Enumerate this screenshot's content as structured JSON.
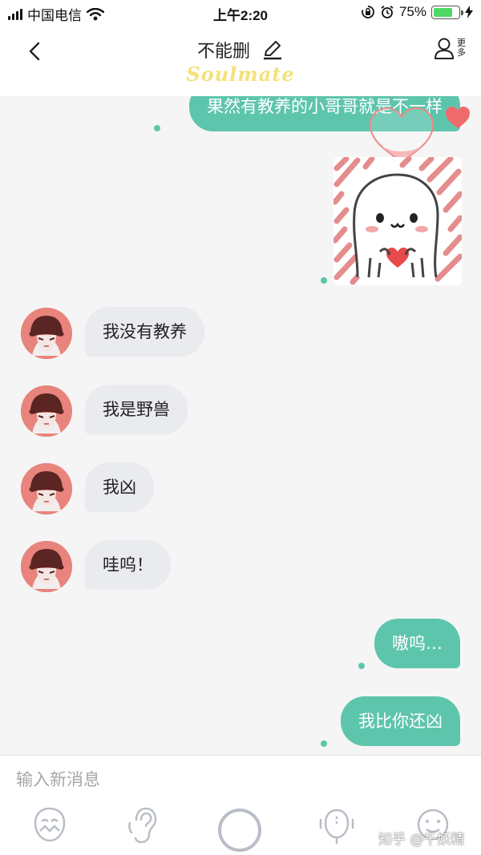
{
  "status_bar": {
    "carrier": "中国电信",
    "time": "上午2:20",
    "battery_percent": "75%",
    "battery_level": 0.75
  },
  "header": {
    "title": "不能删",
    "logo_text": "Soulmate",
    "more_label": "更多",
    "back_icon": "chevron-left-icon",
    "edit_icon": "pencil-icon",
    "more_icon": "person-icon"
  },
  "messages": [
    {
      "side": "out",
      "type": "text",
      "text": "果然有教养的小哥哥就是不一样"
    },
    {
      "side": "out",
      "type": "sticker"
    },
    {
      "side": "in",
      "type": "text",
      "text": "我没有教养"
    },
    {
      "side": "in",
      "type": "text",
      "text": "我是野兽"
    },
    {
      "side": "in",
      "type": "text",
      "text": "我凶"
    },
    {
      "side": "in",
      "type": "text",
      "text": "哇呜！"
    },
    {
      "side": "out",
      "type": "text",
      "text": "嗷呜…"
    },
    {
      "side": "out",
      "type": "text",
      "text": "我比你还凶"
    }
  ],
  "input": {
    "placeholder": "输入新消息"
  },
  "toolbar": {
    "icons": [
      "face-mask-icon",
      "ear-icon",
      "record-circle-icon",
      "microphone-face-icon",
      "smiley-face-icon"
    ]
  },
  "watermark": "知乎 @千妖精",
  "colors": {
    "accent": "#5ec5ad",
    "incoming_bubble": "#e9ebef",
    "battery": "#4cd964",
    "avatar_bg": "#e8847c",
    "heart": "#ef6b6b",
    "logo": "#f5e17a"
  }
}
